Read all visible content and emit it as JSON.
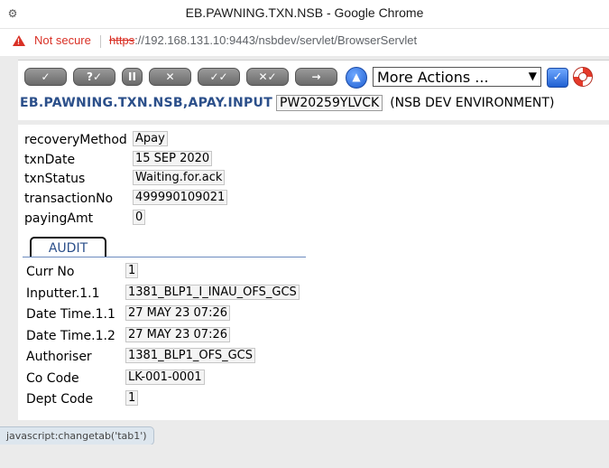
{
  "window": {
    "title": "EB.PAWNING.TXN.NSB - Google Chrome"
  },
  "address_bar": {
    "security_label": "Not secure",
    "url_protocol": "https",
    "url_rest": "://192.168.131.10:9443/nsbdev/servlet/BrowserServlet"
  },
  "toolbar": {
    "buttons": [
      "✓",
      "?✓",
      "II",
      "✕",
      "✓✓",
      "✕✓",
      "→"
    ],
    "actions_selected": "More Actions ...",
    "go_icon": "✓"
  },
  "app": {
    "name": "EB.PAWNING.TXN.NSB,APAY.INPUT",
    "txn_id": "PW20259YLVCK",
    "environment": "(NSB DEV ENVIRONMENT)"
  },
  "fields": [
    {
      "label": "recoveryMethod",
      "value": "Apay"
    },
    {
      "label": "txnDate",
      "value": "15 SEP 2020"
    },
    {
      "label": "txnStatus",
      "value": "Waiting.for.ack"
    },
    {
      "label": "transactionNo",
      "value": "499990109021"
    },
    {
      "label": "payingAmt",
      "value": "0"
    }
  ],
  "tab": {
    "audit_label": "AUDIT"
  },
  "audit": [
    {
      "label": "Curr No",
      "value": "1"
    },
    {
      "label": "Inputter.1.1",
      "value": "1381_BLP1_I_INAU_OFS_GCS"
    },
    {
      "label": "Date Time.1.1",
      "value": "27 MAY 23 07:26"
    },
    {
      "label": "Date Time.1.2",
      "value": "27 MAY 23 07:26"
    },
    {
      "label": "Authoriser",
      "value": "1381_BLP1_OFS_GCS"
    },
    {
      "label": "Co Code",
      "value": "LK-001-0001"
    },
    {
      "label": "Dept Code",
      "value": "1"
    }
  ],
  "status_bar": {
    "text": "javascript:changetab('tab1')"
  },
  "icons": {
    "browser": "browser-icon",
    "warning": "warning-icon",
    "commit": "up-arrow-icon",
    "help": "lifebuoy-icon"
  },
  "colors": {
    "accent": "#2b4f8a",
    "warning": "#d93025",
    "page_bg": "#ebebeb"
  }
}
